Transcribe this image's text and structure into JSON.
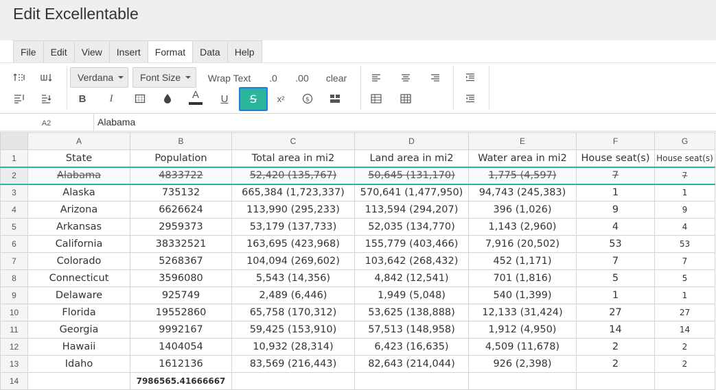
{
  "app": {
    "title": "Edit Excellentable"
  },
  "menu": [
    "File",
    "Edit",
    "View",
    "Insert",
    "Format",
    "Data",
    "Help"
  ],
  "menu_active": "Format",
  "toolbar": {
    "font_family": "Verdana",
    "font_size": "Font Size",
    "wrap_text": "Wrap Text",
    "decrease_decimal": ".0",
    "increase_decimal": ".00",
    "clear": "clear",
    "bold": "B",
    "italic": "I",
    "font_color": "A",
    "underline": "U",
    "strikethrough": "S",
    "superscript": "x²",
    "accent_color": "#2bb59d"
  },
  "formula_bar": {
    "cell_ref": "A2",
    "value": "Alabama"
  },
  "sheet": {
    "columns": [
      "A",
      "B",
      "C",
      "D",
      "E",
      "F",
      "G"
    ],
    "row_numbers": [
      "1",
      "2",
      "3",
      "4",
      "5",
      "6",
      "7",
      "8",
      "9",
      "10",
      "11",
      "12",
      "13",
      "14"
    ],
    "header_row": [
      "State",
      "Population",
      "Total area in mi2",
      "Land area in mi2",
      "Water area in mi2",
      "House seat(s)",
      "House seat(s)"
    ],
    "rows": [
      [
        "Alabama",
        "4833722",
        "52,420 (135,767)",
        "50,645 (131,170)",
        "1,775 (4,597)",
        "7",
        "7"
      ],
      [
        "Alaska",
        "735132",
        "665,384 (1,723,337)",
        "570,641 (1,477,950)",
        "94,743 (245,383)",
        "1",
        "1"
      ],
      [
        "Arizona",
        "6626624",
        "113,990 (295,233)",
        "113,594 (294,207)",
        "396 (1,026)",
        "9",
        "9"
      ],
      [
        "Arkansas",
        "2959373",
        "53,179 (137,733)",
        "52,035 (134,770)",
        "1,143 (2,960)",
        "4",
        "4"
      ],
      [
        "California",
        "38332521",
        "163,695 (423,968)",
        "155,779 (403,466)",
        "7,916 (20,502)",
        "53",
        "53"
      ],
      [
        "Colorado",
        "5268367",
        "104,094 (269,602)",
        "103,642 (268,432)",
        "452 (1,171)",
        "7",
        "7"
      ],
      [
        "Connecticut",
        "3596080",
        "5,543 (14,356)",
        "4,842 (12,541)",
        "701 (1,816)",
        "5",
        "5"
      ],
      [
        "Delaware",
        "925749",
        "2,489 (6,446)",
        "1,949 (5,048)",
        "540 (1,399)",
        "1",
        "1"
      ],
      [
        "Florida",
        "19552860",
        "65,758 (170,312)",
        "53,625 (138,888)",
        "12,133 (31,424)",
        "27",
        "27"
      ],
      [
        "Georgia",
        "9992167",
        "59,425 (153,910)",
        "57,513 (148,958)",
        "1,912 (4,950)",
        "14",
        "14"
      ],
      [
        "Hawaii",
        "1404054",
        "10,932 (28,314)",
        "6,423 (16,635)",
        "4,509 (11,678)",
        "2",
        "2"
      ],
      [
        "Idaho",
        "1612136",
        "83,569 (216,443)",
        "82,643 (214,044)",
        "926 (2,398)",
        "2",
        "2"
      ]
    ],
    "summary_row": [
      "",
      "7986565.41666667",
      "",
      "",
      "",
      "",
      ""
    ],
    "selected_row": 2
  }
}
